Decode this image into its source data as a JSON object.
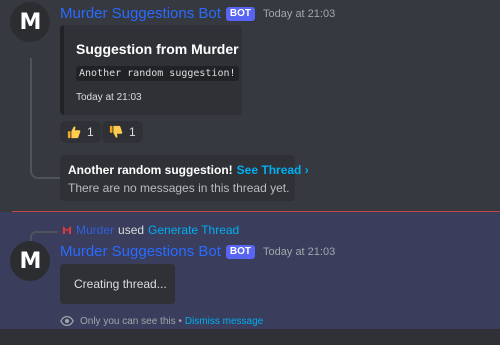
{
  "message1": {
    "avatar_letter": "M",
    "username": "Murder Suggestions Bot",
    "bot_badge": "BOT",
    "timestamp": "Today at 21:03",
    "embed": {
      "title": "Suggestion from Murder",
      "code": "Another random suggestion!",
      "footer": "Today at 21:03"
    },
    "reactions": [
      {
        "emoji": "thumbs-up",
        "count": "1"
      },
      {
        "emoji": "thumbs-down",
        "count": "1"
      }
    ],
    "thread": {
      "title": "Another random suggestion!",
      "link": "See Thread ›",
      "subtitle": "There are no messages in this thread yet."
    }
  },
  "message2": {
    "reply": {
      "name": "Murder",
      "used": "used",
      "command": "Generate Thread"
    },
    "avatar_letter": "M",
    "username": "Murder Suggestions Bot",
    "bot_badge": "BOT",
    "timestamp": "Today at 21:03",
    "body": "Creating thread...",
    "ephemeral_note": "Only you can see this •",
    "dismiss": "Dismiss message"
  },
  "colors": {
    "background": "#36393f",
    "username": "#2a6bff",
    "link": "#00aff4",
    "divider": "#c64646",
    "highlight": "#3a3d5b"
  }
}
